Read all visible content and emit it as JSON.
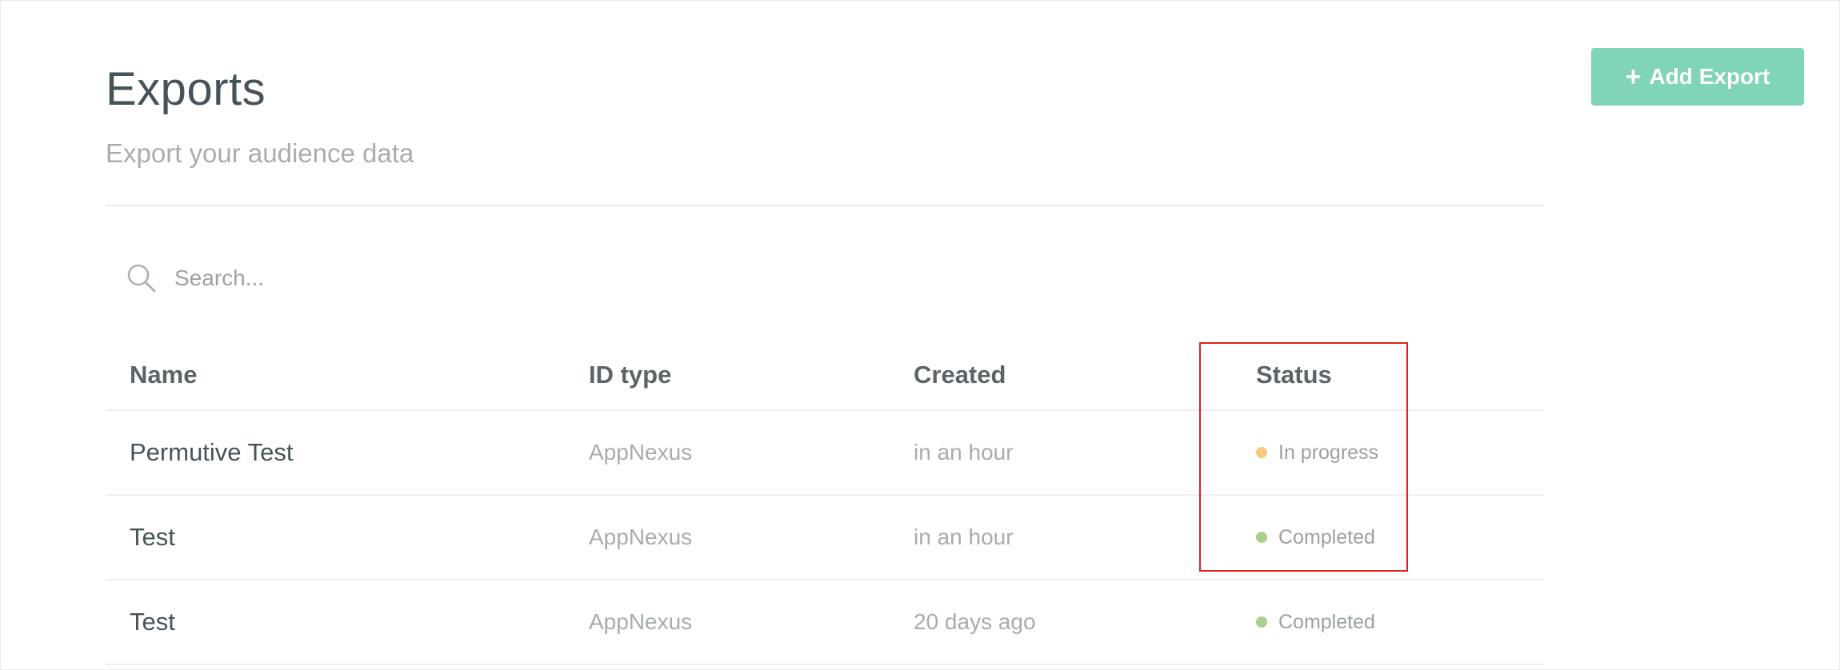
{
  "header": {
    "title": "Exports",
    "subtitle": "Export your audience data",
    "add_button_label": "Add Export",
    "add_button_plus": "+"
  },
  "search": {
    "placeholder": "Search...",
    "icon": "search-icon"
  },
  "table": {
    "columns": {
      "name": "Name",
      "id_type": "ID type",
      "created": "Created",
      "status": "Status"
    },
    "rows": [
      {
        "name": "Permutive Test",
        "id_type": "AppNexus",
        "created": "in an hour",
        "status": "In progress",
        "status_color": "#f8c97d"
      },
      {
        "name": "Test",
        "id_type": "AppNexus",
        "created": "in an hour",
        "status": "Completed",
        "status_color": "#a9d18e"
      },
      {
        "name": "Test",
        "id_type": "AppNexus",
        "created": "20 days ago",
        "status": "Completed",
        "status_color": "#a9d18e"
      }
    ]
  },
  "colors": {
    "accent": "#7fd5b6",
    "title": "#46545a",
    "muted": "#a9adb0",
    "highlight": "#e02020"
  }
}
